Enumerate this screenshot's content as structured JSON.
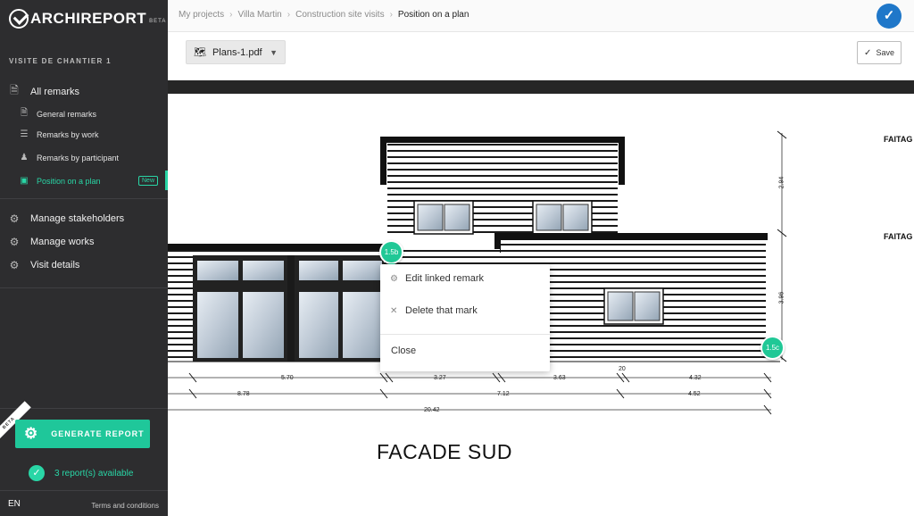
{
  "app": {
    "name": "ARCHIREPORT",
    "beta": "BETA"
  },
  "sidebar": {
    "section_title": "VISITE DE CHANTIER 1",
    "items": [
      {
        "label": "All remarks",
        "icon": "document-icon"
      },
      {
        "label": "General remarks",
        "icon": "document-icon"
      },
      {
        "label": "Remarks by work",
        "icon": "layers-icon"
      },
      {
        "label": "Remarks by participant",
        "icon": "people-icon"
      },
      {
        "label": "Position on a plan",
        "icon": "map-icon",
        "badge": "New",
        "active": true
      },
      {
        "label": "Manage stakeholders",
        "icon": "user-gear-icon"
      },
      {
        "label": "Manage works",
        "icon": "layers-gear-icon"
      },
      {
        "label": "Visit details",
        "icon": "gear-icon"
      }
    ],
    "generate_button": "GENERATE REPORT",
    "beta_ribbon": "BETA",
    "reports_available": "3 report(s) available",
    "language": "EN",
    "terms": "Terms and conditions"
  },
  "breadcrumb": {
    "items": [
      "My projects",
      "Villa Martin",
      "Construction site visits",
      "Position on a plan"
    ]
  },
  "toolbar": {
    "plan_file": "Plans-1.pdf",
    "save_label": "Save"
  },
  "plan": {
    "title": "FACADE SUD",
    "ridge_labels": [
      "FAITAG",
      "FAITAG"
    ],
    "dimensions_row1": [
      "5.70",
      "3.27",
      "3.63",
      "4.32"
    ],
    "dimensions_row1_extra": "20",
    "dimensions_row2": [
      "8.78",
      "7.12",
      "4.52"
    ],
    "dimensions_row3": [
      "20.42"
    ],
    "vertical_dimensions": [
      "2.94",
      "3.96"
    ],
    "markers": [
      "1.5b",
      "1.5c"
    ]
  },
  "context_menu": {
    "edit": "Edit linked remark",
    "delete": "Delete that mark",
    "close": "Close"
  },
  "colors": {
    "sidebar_bg": "#2d2d2f",
    "accent": "#29d6a6",
    "marker": "#20c896",
    "top_check": "#1f77c9"
  }
}
